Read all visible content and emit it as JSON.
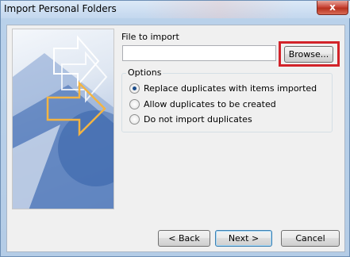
{
  "window": {
    "title": "Import Personal Folders",
    "close_glyph": "x"
  },
  "file": {
    "label": "File to import",
    "value": "",
    "browse_label": "Browse..."
  },
  "options": {
    "legend": "Options",
    "choices": [
      {
        "label": "Replace duplicates with items imported",
        "checked": true
      },
      {
        "label": "Allow duplicates to be created",
        "checked": false
      },
      {
        "label": "Do not import duplicates",
        "checked": false
      }
    ]
  },
  "buttons": {
    "back": "< Back",
    "next": "Next >",
    "cancel": "Cancel"
  },
  "colors": {
    "highlight": "#d2232a",
    "accent": "#1c4d8a"
  },
  "side_image": {
    "icon": "import-arrows-graphic"
  }
}
